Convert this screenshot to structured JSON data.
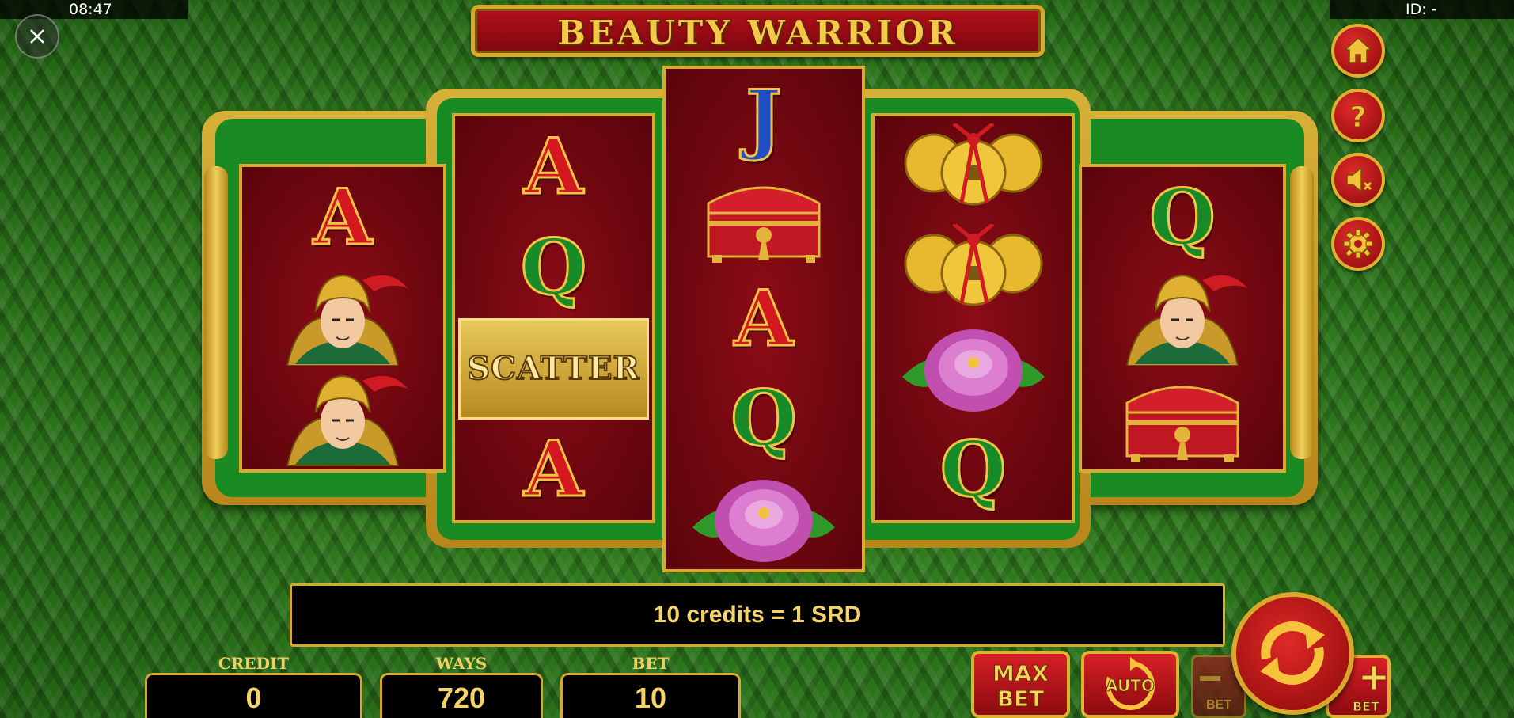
{
  "status_bar": {
    "time": "08:47",
    "id_label": "ID: -"
  },
  "game": {
    "title": "BEAUTY WARRIOR"
  },
  "reels": [
    [
      {
        "type": "letter",
        "text": "A",
        "color": "red"
      },
      {
        "type": "warrior"
      },
      {
        "type": "warrior"
      }
    ],
    [
      {
        "type": "letter",
        "text": "A",
        "color": "red"
      },
      {
        "type": "letter",
        "text": "Q",
        "color": "green"
      },
      {
        "type": "scatter",
        "text": "SCATTER"
      },
      {
        "type": "letter",
        "text": "A",
        "color": "red"
      }
    ],
    [
      {
        "type": "letter",
        "text": "J",
        "color": "blue"
      },
      {
        "type": "chest"
      },
      {
        "type": "letter",
        "text": "A",
        "color": "red"
      },
      {
        "type": "letter",
        "text": "Q",
        "color": "green"
      },
      {
        "type": "flower"
      }
    ],
    [
      {
        "type": "coins"
      },
      {
        "type": "coins"
      },
      {
        "type": "flower"
      },
      {
        "type": "letter",
        "text": "Q",
        "color": "green"
      }
    ],
    [
      {
        "type": "letter",
        "text": "Q",
        "color": "green"
      },
      {
        "type": "warrior"
      },
      {
        "type": "chest"
      }
    ]
  ],
  "info": {
    "message": "10 credits = 1 SRD"
  },
  "fields": {
    "credit_label": "CREDIT",
    "credit_value": "0",
    "ways_label": "WAYS",
    "ways_value": "720",
    "bet_label": "BET",
    "bet_value": "10"
  },
  "buttons": {
    "max_bet_line1": "MAX",
    "max_bet_line2": "BET",
    "auto_label": "AUTO",
    "bet_minus_label": "BET",
    "bet_plus_label": "BET"
  },
  "colors": {
    "accent_gold": "#d9a82a",
    "reel_red": "#8c0c16",
    "felt_green": "#2f7d1c"
  }
}
